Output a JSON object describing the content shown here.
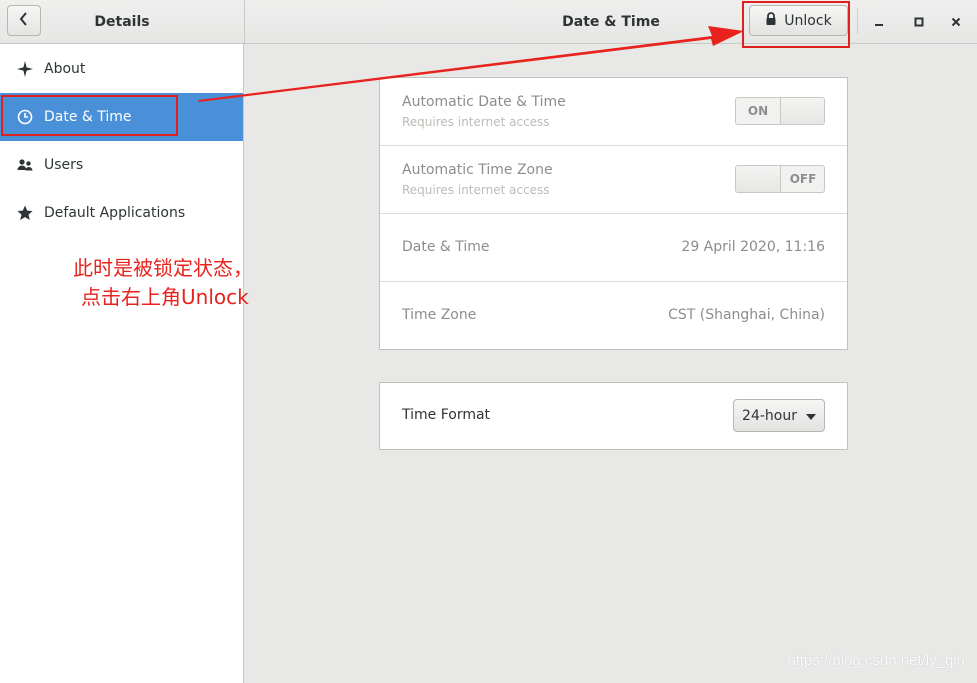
{
  "header": {
    "sidebar_title": "Details",
    "panel_title": "Date & Time",
    "unlock_label": "Unlock",
    "back_icon": "chevron-left-icon",
    "window_controls": [
      "minimize-icon",
      "maximize-icon",
      "close-icon"
    ]
  },
  "sidebar": {
    "items": [
      {
        "label": "About",
        "icon": "sparkle-icon"
      },
      {
        "label": "Date & Time",
        "icon": "clock-icon",
        "active": true
      },
      {
        "label": "Users",
        "icon": "users-icon"
      },
      {
        "label": "Default Applications",
        "icon": "star-icon"
      }
    ],
    "annotation_line1": "此时是被锁定状态，",
    "annotation_line2": "点击右上角Unlock"
  },
  "main": {
    "settings": [
      {
        "title": "Automatic Date & Time",
        "subtitle": "Requires internet access",
        "switch_on": "ON",
        "state": "on"
      },
      {
        "title": "Automatic Time Zone",
        "subtitle": "Requires internet access",
        "switch_off": "OFF",
        "state": "off"
      },
      {
        "title": "Date & Time",
        "value": "29 April 2020, 11:16"
      },
      {
        "title": "Time Zone",
        "value": "CST (Shanghai, China)"
      }
    ],
    "time_format": {
      "title": "Time Format",
      "value": "24-hour"
    }
  },
  "colors": {
    "accent": "#4a90d9",
    "annotation_red": "#e02020"
  },
  "watermark": "https://blog.csdn.net/ly_qiu"
}
